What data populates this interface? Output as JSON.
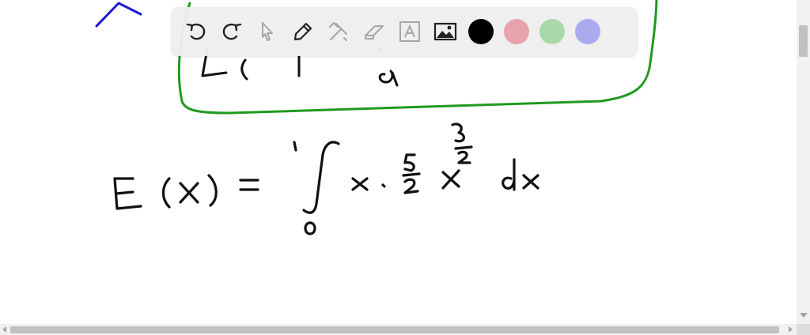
{
  "colors": {
    "ink_black": "#111111",
    "ink_blue": "#1a1ad0",
    "box_green": "#1f9a1f",
    "swatch_black": "#000000",
    "swatch_red": "#e8a3aa",
    "swatch_green": "#a8d8a8",
    "swatch_purple": "#aaaaee",
    "toolbar_bg": "#eeeeee"
  },
  "toolbar": {
    "tools": [
      {
        "icon": "undo-icon",
        "enabled": true
      },
      {
        "icon": "redo-icon",
        "enabled": true
      },
      {
        "icon": "select-pointer-icon",
        "enabled": false
      },
      {
        "icon": "pen-icon",
        "enabled": true
      },
      {
        "icon": "tools-icon",
        "enabled": false
      },
      {
        "icon": "eraser-icon",
        "enabled": false
      },
      {
        "icon": "text-icon",
        "enabled": false
      },
      {
        "icon": "image-icon",
        "enabled": true
      }
    ],
    "swatches": [
      "black",
      "red",
      "green",
      "purple"
    ]
  }
}
